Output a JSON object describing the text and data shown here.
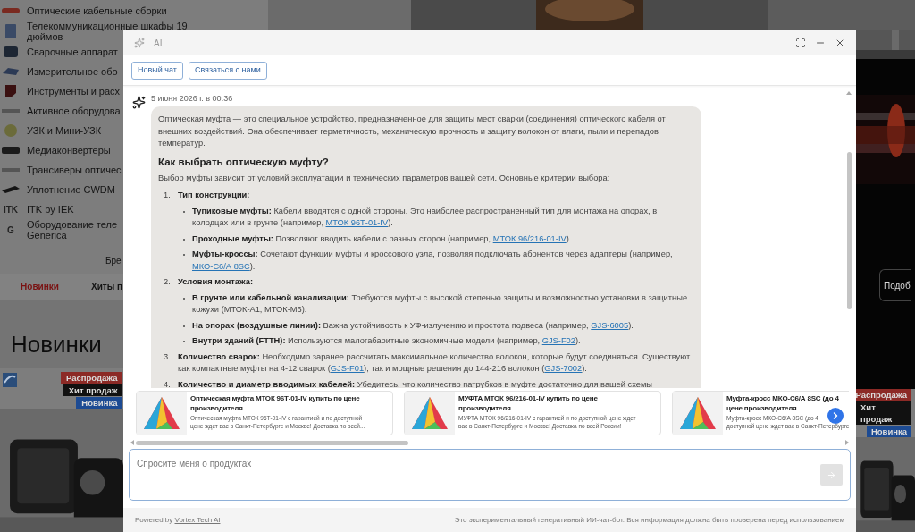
{
  "background": {
    "categories": [
      {
        "lines": [
          "Оптические кабельные сборки"
        ]
      },
      {
        "lines": [
          "Телекоммуникационные шкафы 19",
          "дюймов"
        ]
      },
      {
        "lines": [
          "Сварочные аппарат"
        ]
      },
      {
        "lines": [
          "Измерительное обо"
        ]
      },
      {
        "lines": [
          "Инструменты и расх"
        ]
      },
      {
        "lines": [
          "Активное оборудова"
        ]
      },
      {
        "lines": [
          "УЗК и Мини-УЗК"
        ]
      },
      {
        "lines": [
          "Медиаконвертеры"
        ]
      },
      {
        "lines": [
          "Трансиверы оптичес"
        ]
      },
      {
        "lines": [
          "Уплотнение CWDM"
        ]
      },
      {
        "kind": "logo",
        "logo": "ITK",
        "lines": [
          "ITK by IEK"
        ]
      },
      {
        "kind": "logo",
        "logo": "G",
        "lines": [
          "Оборудование теле",
          "Generica"
        ]
      }
    ],
    "brands_label": "Бре",
    "tabs": [
      {
        "label": "Новинки",
        "selected": true
      },
      {
        "label": "Хиты п",
        "selected": false
      }
    ],
    "section_title": "Новинки",
    "badges_left": [
      {
        "label": "Распродажа",
        "kind": "sale"
      },
      {
        "label": "Хит продаж",
        "kind": "hit"
      },
      {
        "label": "Новинка",
        "kind": "new"
      }
    ],
    "side_button": "Подоб",
    "badges_right": [
      {
        "label": "Распродажа",
        "kind": "sale"
      },
      {
        "label": "Хит продаж",
        "kind": "hit"
      },
      {
        "label": "Новинка",
        "kind": "new"
      }
    ]
  },
  "chat": {
    "title": "AI",
    "buttons": [
      "Новый чат",
      "Связаться с нами"
    ],
    "message": {
      "date": "5 июня 2026 г. в 00:36",
      "blocks": [
        {
          "kind": "paragraph",
          "text": "Оптическая муфта — это специальное устройство, предназначенное для защиты мест сварки (соединения) оптического кабеля от внешних воздействий. Она обеспечивает герметичность, механическую прочность и защиту волокон от влаги, пыли и перепадов температур."
        },
        {
          "kind": "heading",
          "text": "Как выбрать оптическую муфту?"
        },
        {
          "kind": "paragraph",
          "text": "Выбор муфты зависит от условий эксплуатации и технических параметров вашей сети. Основные критерии выбора:"
        },
        {
          "kind": "ordered",
          "items": [
            {
              "number": "1.",
              "label": "Тип конструкции:",
              "bullets": [
                {
                  "label": "Тупиковые муфты:",
                  "segments": [
                    {
                      "kind": "text",
                      "text": " Кабели вводятся с одной стороны. Это наиболее распространенный тип для монтажа на опорах, в колодцах или в грунте (например, "
                    },
                    {
                      "kind": "link",
                      "text": "МТОК 96Т-01-IV"
                    },
                    {
                      "kind": "text",
                      "text": ")."
                    }
                  ]
                },
                {
                  "label": "Проходные муфты:",
                  "segments": [
                    {
                      "kind": "text",
                      "text": " Позволяют вводить кабели с разных сторон (например, "
                    },
                    {
                      "kind": "link",
                      "text": "МТОК 96/216-01-IV"
                    },
                    {
                      "kind": "text",
                      "text": ")."
                    }
                  ]
                },
                {
                  "label": "Муфты-кроссы:",
                  "segments": [
                    {
                      "kind": "text",
                      "text": " Сочетают функции муфты и кроссового узла, позволяя подключать абонентов через адаптеры (например, "
                    },
                    {
                      "kind": "link",
                      "text": "МКО-С6/А 8SC"
                    },
                    {
                      "kind": "text",
                      "text": ")."
                    }
                  ]
                }
              ]
            },
            {
              "number": "2.",
              "label": "Условия монтажа:",
              "bullets": [
                {
                  "label": "В грунте или кабельной канализации:",
                  "segments": [
                    {
                      "kind": "text",
                      "text": " Требуются муфты с высокой степенью защиты и возможностью установки в защитные кожухи (МТОК-А1, МТОК-М6)."
                    }
                  ]
                },
                {
                  "label": "На опорах (воздушные линии):",
                  "segments": [
                    {
                      "kind": "text",
                      "text": " Важна устойчивость к УФ-излучению и простота подвеса (например, "
                    },
                    {
                      "kind": "link",
                      "text": "GJS-6005"
                    },
                    {
                      "kind": "text",
                      "text": ")."
                    }
                  ]
                },
                {
                  "label": "Внутри зданий (FTTH):",
                  "segments": [
                    {
                      "kind": "text",
                      "text": " Используются малогабаритные экономичные модели (например, "
                    },
                    {
                      "kind": "link",
                      "text": "GJS-F02"
                    },
                    {
                      "kind": "text",
                      "text": ")."
                    }
                  ]
                }
              ]
            },
            {
              "number": "3.",
              "label": "Количество сварок:",
              "segments": [
                {
                  "kind": "text",
                  "text": " Необходимо заранее рассчитать максимальное количество волокон, которые будут соединяться. Существуют как компактные муфты на 4-12 сварок ("
                },
                {
                  "kind": "link",
                  "text": "GJS-F01"
                },
                {
                  "kind": "text",
                  "text": "), так и мощные решения до 144-216 волокон ("
                },
                {
                  "kind": "link",
                  "text": "GJS-7002"
                },
                {
                  "kind": "text",
                  "text": ")."
                }
              ]
            },
            {
              "number": "4.",
              "label": "Количество и диаметр вводимых кабелей:",
              "segments": [
                {
                  "kind": "text",
                  "text": " Убедитесь, что количество патрубков в муфте достаточно для вашей схемы"
                }
              ]
            }
          ]
        }
      ]
    },
    "products": [
      {
        "title_lines": [
          "Оптическая муфта МТОК 96Т-01-IV купить по цене",
          "производителя"
        ],
        "description_lines": [
          "Оптическая муфта МТОК 96Т-01-IV с гарантией и по доступной",
          "цене ждет вас в Санкт-Петербурге и Москве! Доставка по всей..."
        ]
      },
      {
        "title_lines": [
          "МУФТА МТОК 96/216-01-IV купить по цене",
          "производителя"
        ],
        "description_lines": [
          "МУФТА МТОК 96/216-01-IV с гарантией и по доступной цене ждет",
          "вас в Санкт-Петербурге и Москве! Доставка по всей России!"
        ]
      },
      {
        "title_lines": [
          "Муфта-кросс МКО-С6/А 8SC (до 4",
          "цене производителя"
        ],
        "description_lines": [
          "Муфта-кросс МКО-С6/А 8SC (до 4",
          "доступной цене ждет вас в Санкт-Петербурге"
        ]
      }
    ],
    "input": {
      "placeholder": "Спросите меня о продуктах"
    },
    "footer": {
      "powered_prefix": "Powered by",
      "powered_link": "Vortex Tech AI",
      "disclaimer": "Это экспериментальный генеративный ИИ-чат-бот. Вся информация должна быть проверена перед использованием"
    }
  }
}
